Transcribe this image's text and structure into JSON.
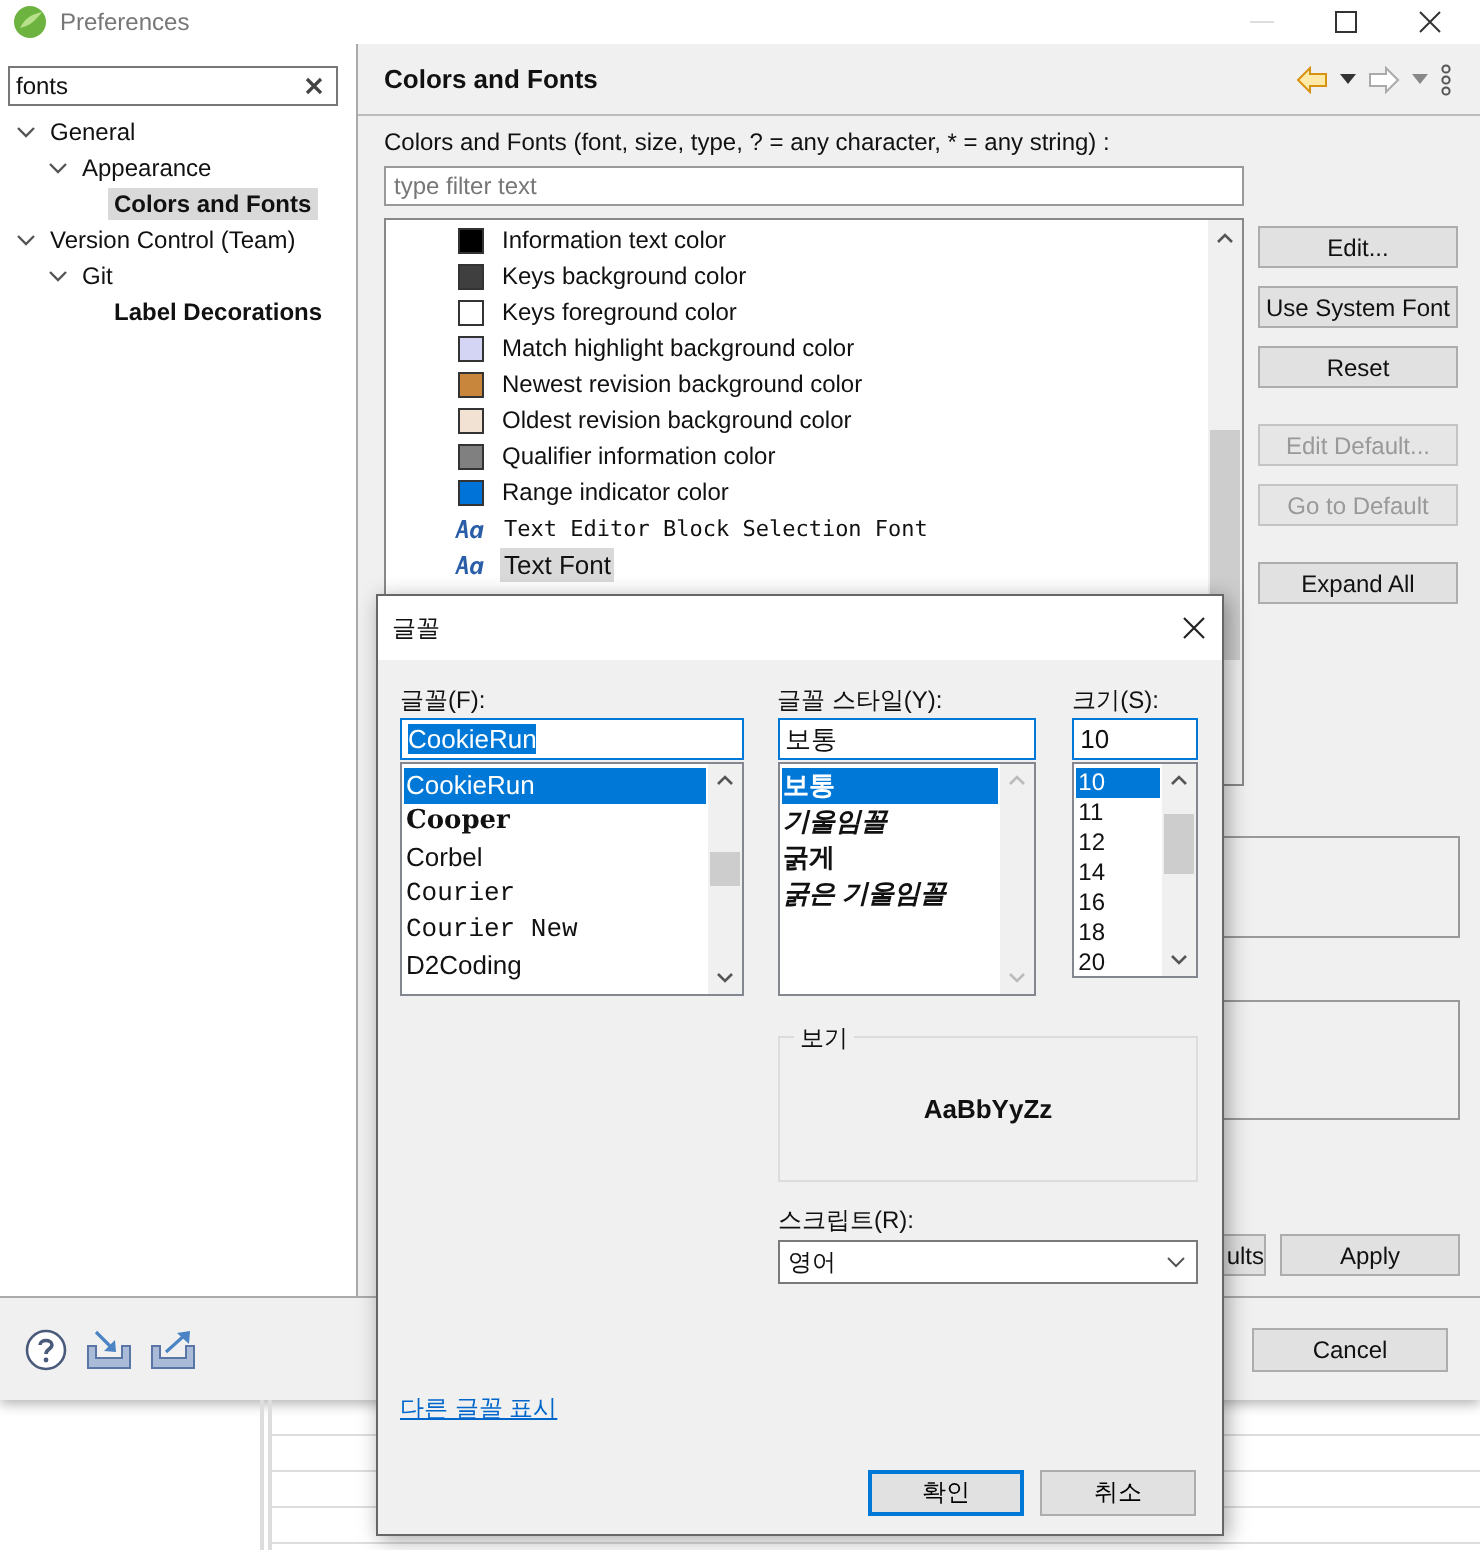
{
  "window": {
    "title": "Preferences"
  },
  "search": {
    "value": "fonts"
  },
  "nav_tree": [
    {
      "label": "General",
      "expanded": true,
      "selected": false,
      "matched": false,
      "children": [
        {
          "label": "Appearance",
          "expanded": true,
          "selected": false,
          "matched": false,
          "children": [
            {
              "label": "Colors and Fonts",
              "selected": true,
              "matched": true
            }
          ]
        }
      ]
    },
    {
      "label": "Version Control (Team)",
      "expanded": true,
      "selected": false,
      "matched": false,
      "children": [
        {
          "label": "Git",
          "expanded": true,
          "selected": false,
          "matched": false,
          "children": [
            {
              "label": "Label Decorations",
              "selected": false,
              "matched": true
            }
          ]
        }
      ]
    }
  ],
  "page": {
    "title": "Colors and Fonts",
    "description": "Colors and Fonts (font, size, type, ? = any character, * = any string) :",
    "filter_placeholder": "type filter text"
  },
  "items": [
    {
      "kind": "color",
      "label": "Information text color",
      "color": "#000000",
      "selected": false
    },
    {
      "kind": "color",
      "label": "Keys background color",
      "color": "#3f3f3f",
      "selected": false
    },
    {
      "kind": "color",
      "label": "Keys foreground color",
      "color": "#ffffff",
      "selected": false
    },
    {
      "kind": "color",
      "label": "Match highlight background color",
      "color": "#d4d4f4",
      "selected": false
    },
    {
      "kind": "color",
      "label": "Newest revision background color",
      "color": "#c8863c",
      "selected": false
    },
    {
      "kind": "color",
      "label": "Oldest revision background color",
      "color": "#f2e2d4",
      "selected": false
    },
    {
      "kind": "color",
      "label": "Qualifier information color",
      "color": "#808080",
      "selected": false
    },
    {
      "kind": "color",
      "label": "Range indicator color",
      "color": "#0073d9",
      "selected": false
    },
    {
      "kind": "font",
      "label": "Text Editor Block Selection Font",
      "mono": true,
      "selected": false
    },
    {
      "kind": "font",
      "label": "Text Font",
      "mono": false,
      "selected": true
    }
  ],
  "side_buttons": [
    {
      "label": "Edit...",
      "disabled": false
    },
    {
      "label": "Use System Font",
      "disabled": false
    },
    {
      "label": "Reset",
      "disabled": false
    },
    {
      "label": "Edit Default...",
      "disabled": true
    },
    {
      "label": "Go to Default",
      "disabled": true
    },
    {
      "label": "Expand All",
      "disabled": false
    }
  ],
  "restore_button": "ults",
  "apply_button": "Apply",
  "cancel_button": "Cancel",
  "font_dialog": {
    "title": "글꼴",
    "font_label": "글꼴(F):",
    "font_value": "CookieRun",
    "font_value_highlighted": true,
    "fonts": [
      {
        "label": "CookieRun",
        "selected": true
      },
      {
        "label": "Cooper",
        "selected": false
      },
      {
        "label": "Corbel",
        "selected": false
      },
      {
        "label": "Courier",
        "selected": false
      },
      {
        "label": "Courier New",
        "selected": false
      },
      {
        "label": "D2Coding",
        "selected": false
      }
    ],
    "style_label": "글꼴 스타일(Y):",
    "style_value": "보통",
    "styles": [
      {
        "label": "보통",
        "selected": true
      },
      {
        "label": "기울임꼴",
        "selected": false
      },
      {
        "label": "굵게",
        "selected": false
      },
      {
        "label": "굵은 기울임꼴",
        "selected": false
      }
    ],
    "size_label": "크기(S):",
    "size_value": "10",
    "sizes": [
      {
        "label": "10",
        "selected": true
      },
      {
        "label": "11",
        "selected": false
      },
      {
        "label": "12",
        "selected": false
      },
      {
        "label": "14",
        "selected": false
      },
      {
        "label": "16",
        "selected": false
      },
      {
        "label": "18",
        "selected": false
      },
      {
        "label": "20",
        "selected": false
      }
    ],
    "preview_label": "보기",
    "sample": "AaBbYyZz",
    "script_label": "스크립트(R):",
    "script_value": "영어",
    "link": "다른 글꼴 표시",
    "ok_button": "확인",
    "cancel_button": "취소"
  }
}
